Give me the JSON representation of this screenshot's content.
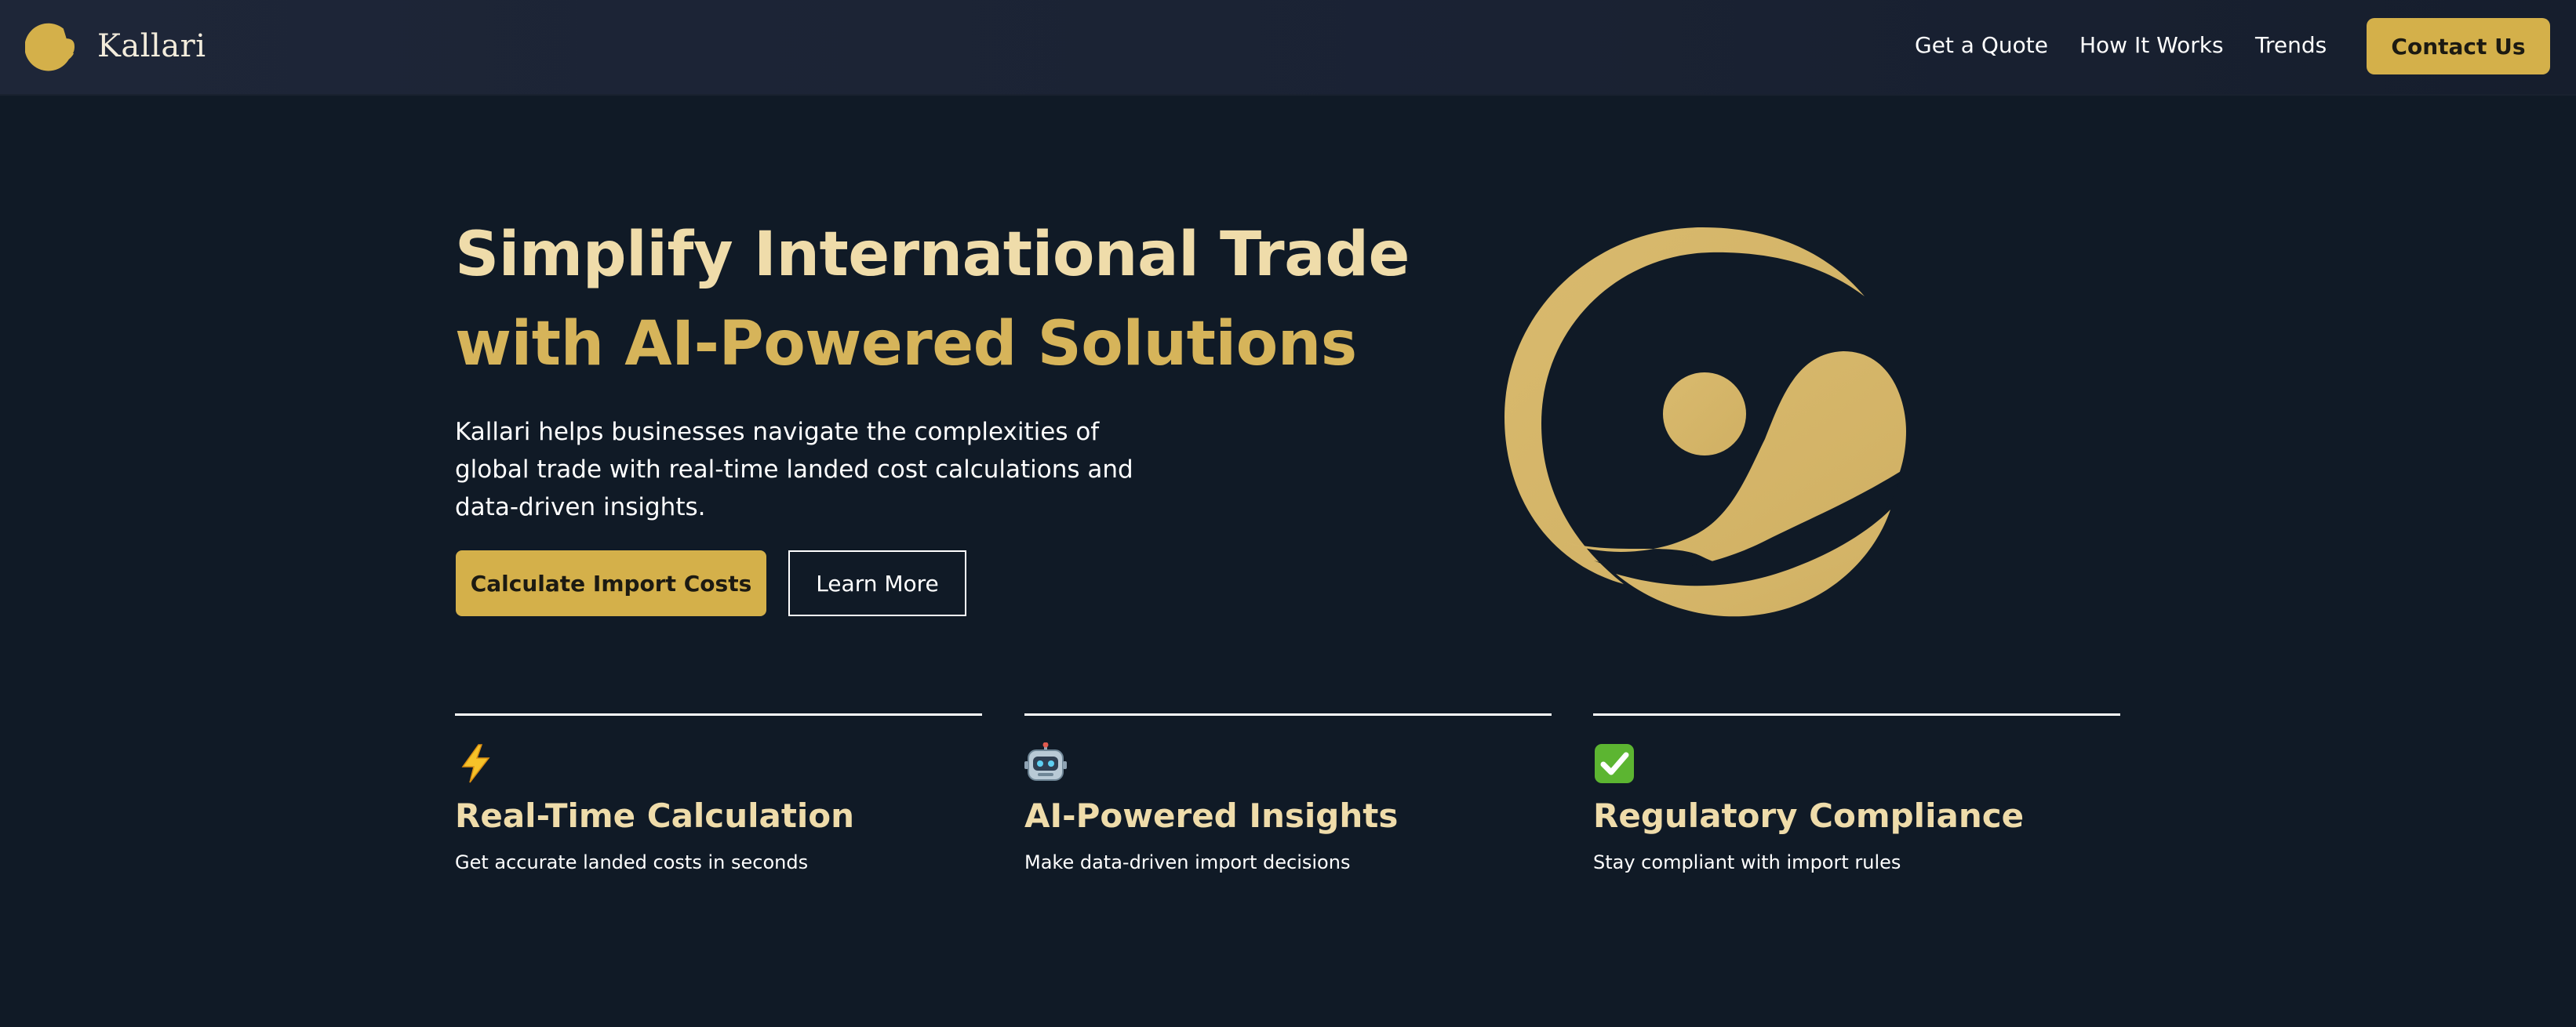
{
  "brand": {
    "name": "Kallari",
    "logo_icon": "kallari-swirl-logo-icon"
  },
  "nav": {
    "links": [
      "Get a Quote",
      "How It Works",
      "Trends"
    ],
    "contact_label": "Contact Us"
  },
  "hero": {
    "title_line_1": "Simplify International Trade",
    "title_line_2": "with AI-Powered Solutions",
    "description": "Kallari helps businesses navigate the complexities of global trade with real-time landed cost calculations and data-driven insights.",
    "primary_cta": "Calculate Import Costs",
    "secondary_cta": "Learn More",
    "logo_icon": "kallari-swirl-logo-icon"
  },
  "features": [
    {
      "icon": "lightning-icon",
      "title": "Real-Time Calculation",
      "text": "Get accurate landed costs in seconds"
    },
    {
      "icon": "robot-icon",
      "title": "AI-Powered Insights",
      "text": "Make data-driven import decisions"
    },
    {
      "icon": "check-mark-icon",
      "title": "Regulatory Compliance",
      "text": "Stay compliant with import rules"
    }
  ],
  "colors": {
    "background": "#101a26",
    "navbar": "#1c2436",
    "accent_gold": "#d4b04a",
    "heading_cream": "#efdcaa",
    "heading_gold": "#d6b45a"
  }
}
